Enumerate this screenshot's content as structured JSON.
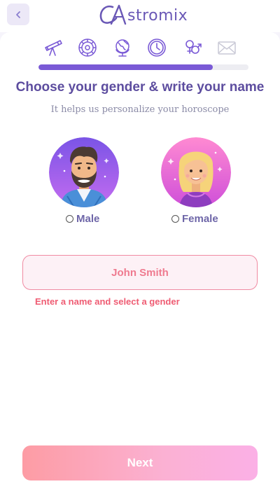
{
  "header": {
    "back_icon": "chevron-left-icon",
    "logo_text": "stromix",
    "logo_mark": "A"
  },
  "steps": [
    {
      "icon": "telescope-icon",
      "state": "done"
    },
    {
      "icon": "zodiac-wheel-icon",
      "state": "done"
    },
    {
      "icon": "globe-icon",
      "state": "done"
    },
    {
      "icon": "clock-icon",
      "state": "done"
    },
    {
      "icon": "gender-icon",
      "state": "current"
    },
    {
      "icon": "envelope-icon",
      "state": "upcoming"
    }
  ],
  "progress": {
    "fraction": 0.83
  },
  "title": "Choose your gender & write your name",
  "subtitle": "It helps us personalize your horoscope",
  "genders": [
    {
      "label": "Male",
      "avatar": "male-avatar",
      "selected": false
    },
    {
      "label": "Female",
      "avatar": "female-avatar",
      "selected": false
    }
  ],
  "name_input": {
    "value": "",
    "placeholder": "John Smith"
  },
  "error": "Enter a name and select a gender",
  "next_label": "Next",
  "colors": {
    "brand": "#6a58b6",
    "title": "#5d4d9f",
    "progress": "#7a5ad6",
    "error": "#ef5c73",
    "button_start": "#fd9ca4",
    "button_end": "#fbb0e6"
  }
}
